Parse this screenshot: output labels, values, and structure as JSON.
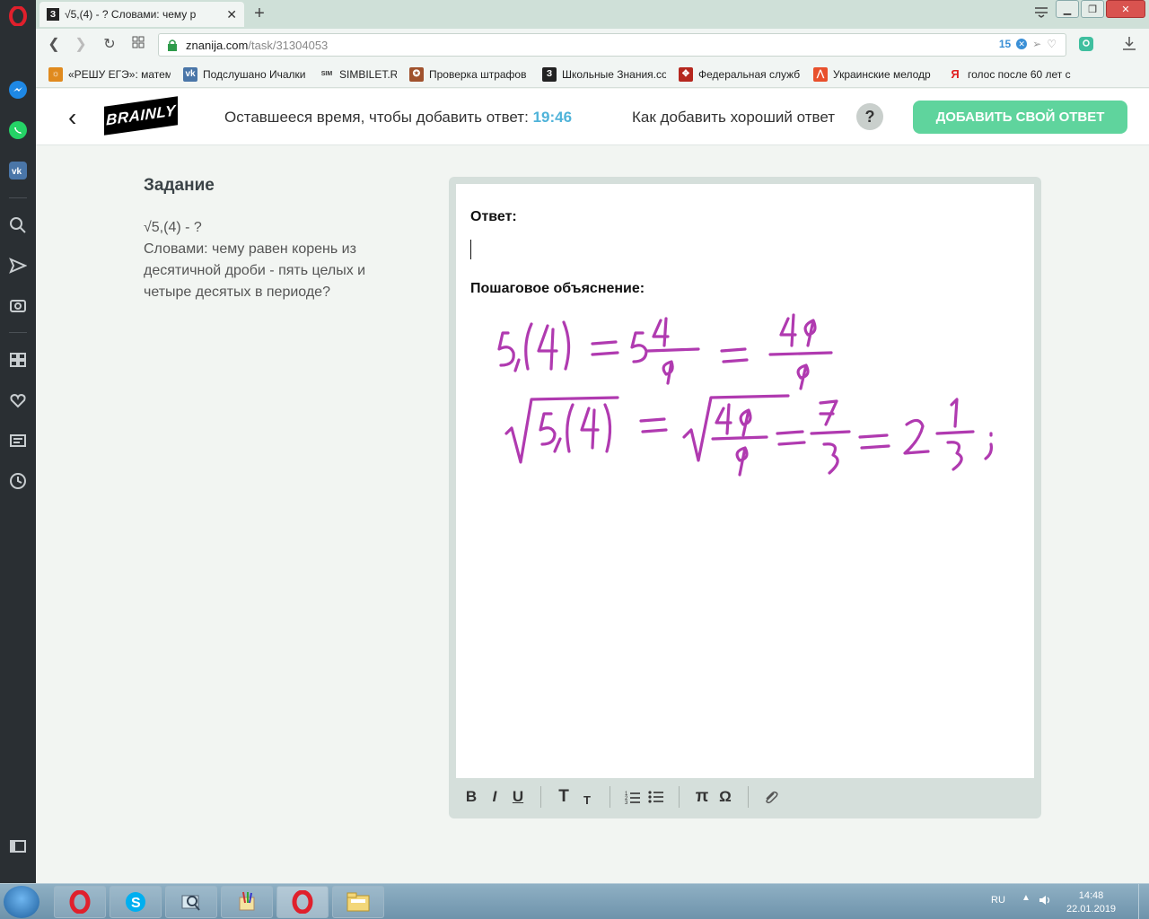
{
  "browser": {
    "tab_title": "√5,(4) - ? Словами: чему р",
    "tab_favicon": "З",
    "url_host": "znanija.com",
    "url_path": "/task/31304053",
    "badge_count": "15",
    "bookmarks": [
      {
        "label": "«РЕШУ ЕГЭ»: матема",
        "icon": "sun-icon",
        "color": "#e08a1e",
        "glyph": "☼"
      },
      {
        "label": "Подслушано Ичалки",
        "icon": "vk-icon",
        "color": "#4a76a8",
        "glyph": "vk"
      },
      {
        "label": "SIMBILET.RU",
        "icon": "sim-icon",
        "color": "#333333",
        "glyph": "SIM"
      },
      {
        "label": "Проверка штрафов",
        "icon": "emblem-icon",
        "color": "#a0522d",
        "glyph": "✪"
      },
      {
        "label": "Школьные Знания.co",
        "icon": "znanija-icon",
        "color": "#222222",
        "glyph": "З"
      },
      {
        "label": "Федеральная служб",
        "icon": "federal-icon",
        "color": "#b5271e",
        "glyph": "✥"
      },
      {
        "label": "Украинские мелодр",
        "icon": "ukr-icon",
        "color": "#e8502c",
        "glyph": "⋀"
      },
      {
        "label": "голос после 60 лет с",
        "icon": "yandex-icon",
        "color": "#ffffff",
        "glyph": "Я"
      }
    ]
  },
  "header": {
    "timer_label": "Оставшееся время, чтобы добавить ответ:",
    "timer_value": "19:46",
    "good_answer_label": "Как добавить хороший ответ",
    "help_label": "?",
    "add_answer_label": "ДОБАВИТЬ СВОЙ ОТВЕТ",
    "logo_text": "BRAINLY"
  },
  "task": {
    "heading": "Задание",
    "body_line1": "√5,(4) - ?",
    "body_line2": "Словами: чему равен корень из десятичной дроби - пять целых и четыре десятых в периоде?"
  },
  "editor": {
    "answer_label": "Ответ:",
    "explanation_label": "Пошаговое объяснение:",
    "toolbar": {
      "bold": "B",
      "italic": "I",
      "underline": "U",
      "text_large": "T",
      "text_small": "T",
      "pi": "π",
      "omega": "Ω"
    }
  },
  "taskbar": {
    "lang": "RU",
    "time": "14:48",
    "date": "22.01.2019"
  },
  "colors": {
    "accent_green": "#5fd49d",
    "timer_blue": "#4fb3d9",
    "handwriting": "#b03ab0"
  }
}
